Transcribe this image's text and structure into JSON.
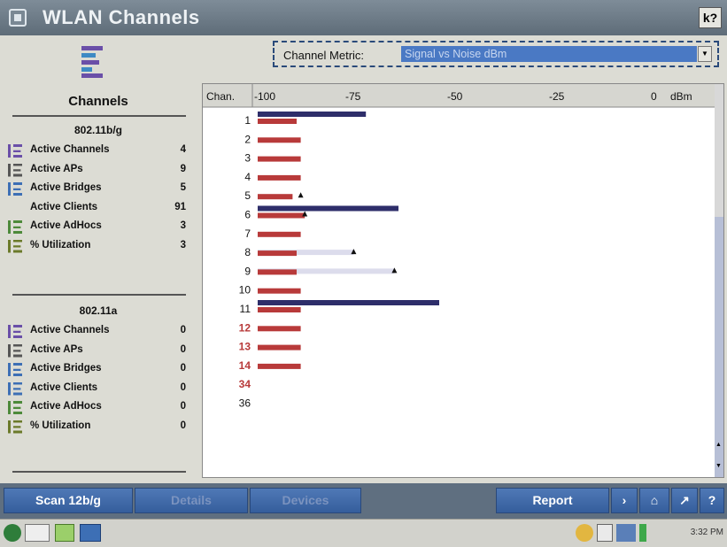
{
  "window": {
    "title": "WLAN Channels",
    "help_label": "k?"
  },
  "sidebar": {
    "heading": "Channels",
    "groups": [
      {
        "title": "802.11b/g",
        "stats": [
          {
            "icon": "channels-icon",
            "label": "Active Channels",
            "value": "4"
          },
          {
            "icon": "ap-icon",
            "label": "Active APs",
            "value": "9"
          },
          {
            "icon": "bridge-icon",
            "label": "Active Bridges",
            "value": "5"
          },
          {
            "icon": "",
            "label": "Active Clients",
            "value": "91"
          },
          {
            "icon": "adhoc-icon",
            "label": "Active AdHocs",
            "value": "3"
          },
          {
            "icon": "utilization-icon",
            "label": "% Utilization",
            "value": "3"
          }
        ]
      },
      {
        "title": "802.11a",
        "stats": [
          {
            "icon": "channels-icon",
            "label": "Active Channels",
            "value": "0"
          },
          {
            "icon": "ap-icon",
            "label": "Active APs",
            "value": "0"
          },
          {
            "icon": "bridge-icon",
            "label": "Active Bridges",
            "value": "0"
          },
          {
            "icon": "clients-icon",
            "label": "Active Clients",
            "value": "0"
          },
          {
            "icon": "adhoc-icon",
            "label": "Active AdHocs",
            "value": "0"
          },
          {
            "icon": "utilization-icon",
            "label": "% Utilization",
            "value": "0"
          }
        ]
      }
    ]
  },
  "metric": {
    "label": "Channel Metric:",
    "selected": "Signal vs Noise dBm"
  },
  "chart_data": {
    "type": "bar",
    "header_label": "Chan.",
    "unit": "dBm",
    "x_ticks": [
      "-100",
      "-75",
      "-50",
      "-25",
      "0"
    ],
    "xlim": [
      -100,
      0
    ],
    "rows": [
      {
        "channel": "1",
        "noise": -90,
        "signal": -73
      },
      {
        "channel": "2",
        "noise": -89
      },
      {
        "channel": "3",
        "noise": -89
      },
      {
        "channel": "4",
        "noise": -89
      },
      {
        "channel": "5",
        "noise": -91,
        "marker": -89
      },
      {
        "channel": "6",
        "noise": -88,
        "signal": -65,
        "marker": -88
      },
      {
        "channel": "7",
        "noise": -89
      },
      {
        "channel": "8",
        "noise": -90,
        "peak": -76,
        "marker": -76
      },
      {
        "channel": "9",
        "noise": -90,
        "peak": -66,
        "marker": -66
      },
      {
        "channel": "10",
        "noise": -89
      },
      {
        "channel": "11",
        "noise": -89,
        "signal": -55
      },
      {
        "channel": "12",
        "noise": -89,
        "highlight": true
      },
      {
        "channel": "13",
        "noise": -89,
        "highlight": true
      },
      {
        "channel": "14",
        "noise": -89,
        "highlight": true
      },
      {
        "channel": "34",
        "highlight": true
      },
      {
        "channel": "36"
      }
    ],
    "colors": {
      "signal": "#2e2e6a",
      "noise": "#b83a3a",
      "peak": "#dcdcec",
      "marker": "#111111",
      "highlight_label": "#b83a3a"
    }
  },
  "buttons": {
    "scan": "Scan 12b/g",
    "details": "Details",
    "devices": "Devices",
    "report": "Report"
  },
  "taskbar": {
    "clock": "3:32 PM"
  }
}
